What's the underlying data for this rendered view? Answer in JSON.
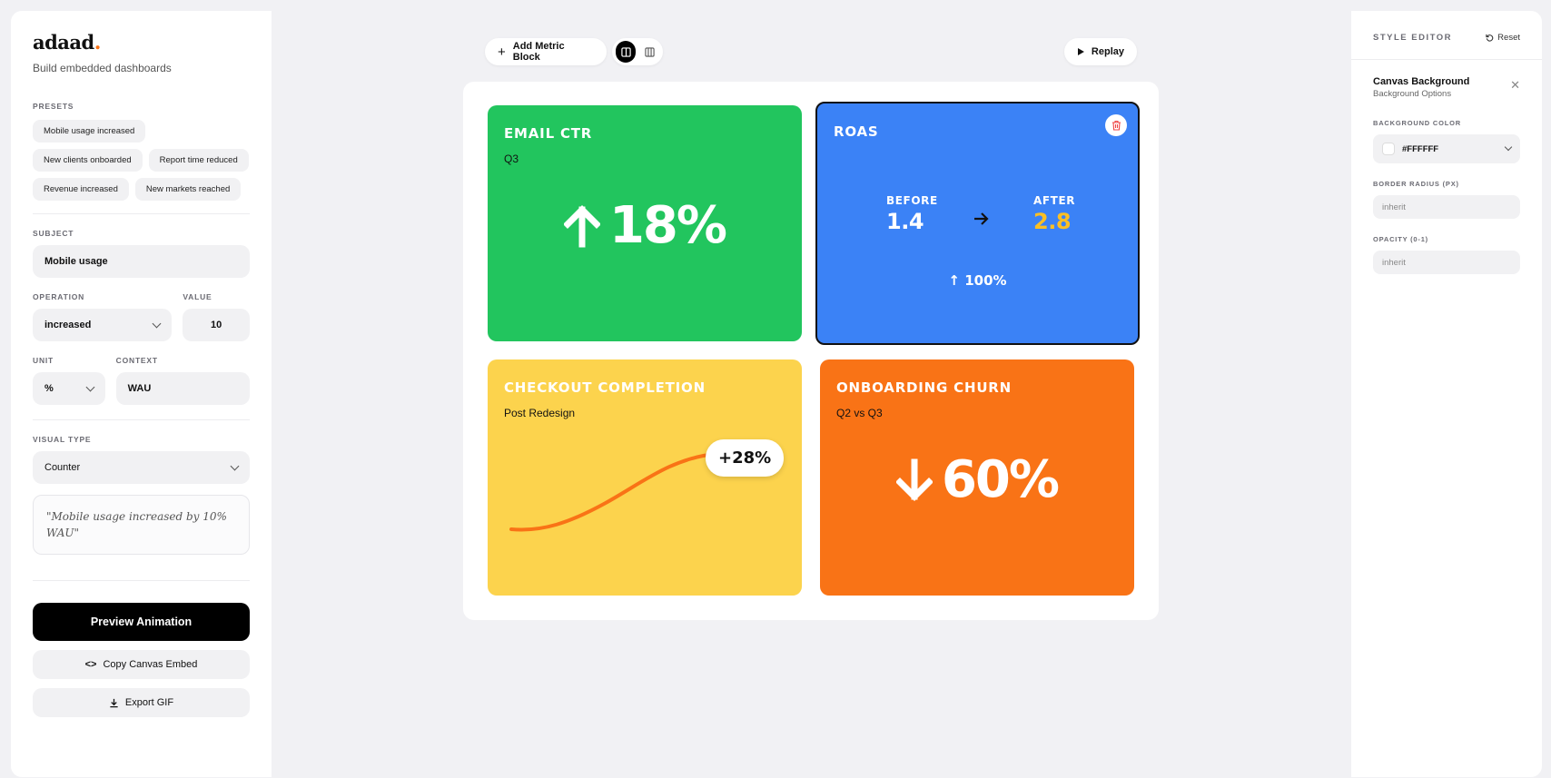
{
  "app": {
    "logo": "adaad",
    "logo_dot": ".",
    "tagline": "Build embedded dashboards"
  },
  "left": {
    "presets_label": "PRESETS",
    "presets": [
      "Mobile usage increased",
      "New clients onboarded",
      "Report time reduced",
      "Revenue increased",
      "New markets reached"
    ],
    "subject_label": "SUBJECT",
    "subject_value": "Mobile usage",
    "operation_label": "OPERATION",
    "operation_value": "increased",
    "value_label": "VALUE",
    "value_value": "10",
    "unit_label": "UNIT",
    "unit_value": "%",
    "context_label": "CONTEXT",
    "context_value": "WAU",
    "visual_type_label": "VISUAL TYPE",
    "visual_type_value": "Counter",
    "preview_text": "\"Mobile usage increased by 10% WAU\"",
    "preview_button": "Preview Animation",
    "copy_button": "Copy Canvas Embed",
    "export_button": "Export GIF"
  },
  "toolbar": {
    "add_label": "Add Metric Block",
    "replay_label": "Replay"
  },
  "cards": {
    "email": {
      "title": "EMAIL CTR",
      "subtitle": "Q3",
      "value": "18%",
      "color": "#22c55e"
    },
    "roas": {
      "title": "ROAS",
      "before_label": "BEFORE",
      "before_value": "1.4",
      "after_label": "AFTER",
      "after_value": "2.8",
      "change": "100%",
      "color": "#3b82f6",
      "after_color": "#fbbf24"
    },
    "checkout": {
      "title": "CHECKOUT COMPLETION",
      "subtitle": "Post Redesign",
      "value": "+28%",
      "color": "#fcd34d"
    },
    "churn": {
      "title": "ONBOARDING CHURN",
      "subtitle": "Q2 vs Q3",
      "value": "60%",
      "color": "#f97316"
    }
  },
  "style_editor": {
    "title": "STYLE EDITOR",
    "reset": "Reset",
    "section_title": "Canvas Background",
    "section_sub": "Background Options",
    "bg_color_label": "BACKGROUND COLOR",
    "bg_color_value": "#FFFFFF",
    "radius_label": "BORDER RADIUS (PX)",
    "radius_placeholder": "inherit",
    "opacity_label": "OPACITY (0-1)",
    "opacity_placeholder": "inherit"
  }
}
